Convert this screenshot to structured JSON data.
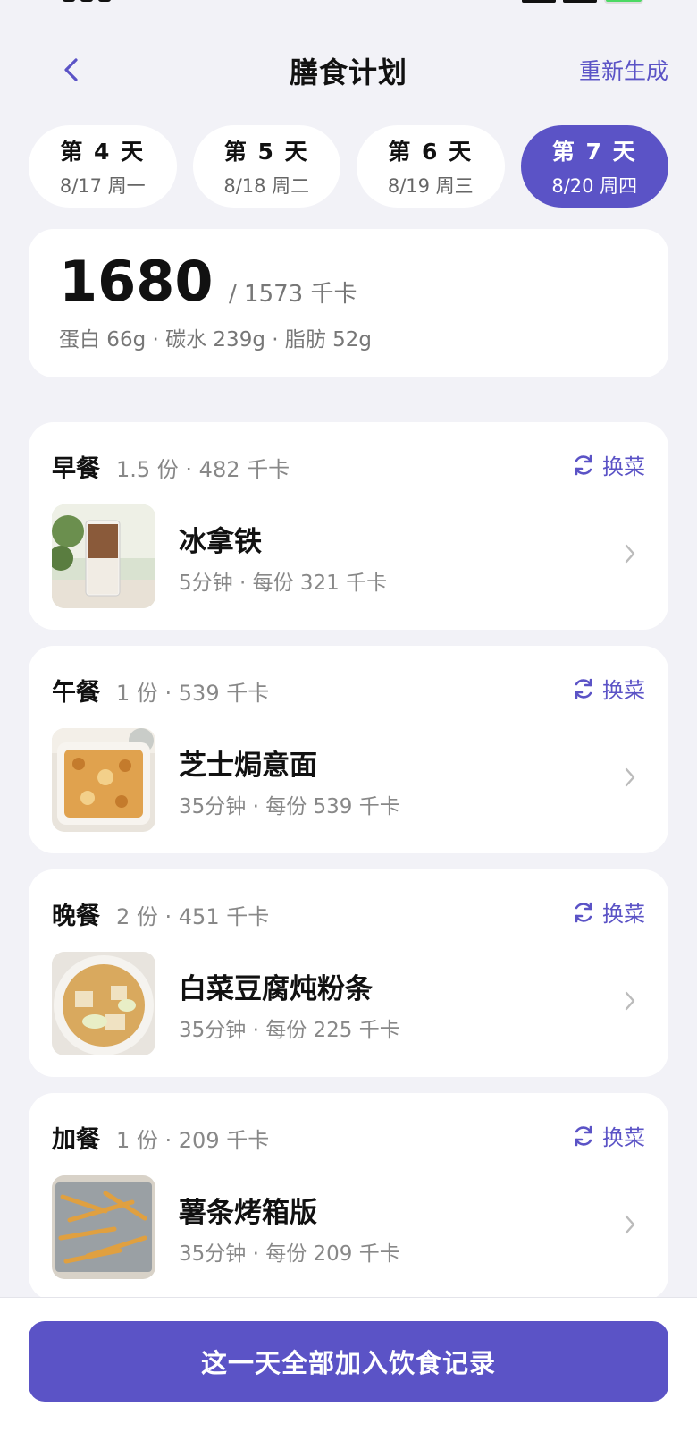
{
  "header": {
    "title": "膳食计划",
    "regenerate_label": "重新生成"
  },
  "day_tabs": [
    {
      "name": "第 4 天",
      "date": "8/17 周一",
      "active": false
    },
    {
      "name": "第 5 天",
      "date": "8/18 周二",
      "active": false
    },
    {
      "name": "第 6 天",
      "date": "8/19 周三",
      "active": false
    },
    {
      "name": "第 7 天",
      "date": "8/20 周四",
      "active": true
    }
  ],
  "summary": {
    "calories": "1680",
    "target": "/ 1573 千卡",
    "macros": "蛋白 66g · 碳水 239g · 脂肪 52g"
  },
  "meals": [
    {
      "type": "早餐",
      "summary": "1.5 份 · 482 千卡",
      "swap_label": "换菜",
      "dish": "冰拿铁",
      "meta": "5分钟 · 每份 321 千卡",
      "thumb_icon": "iced-latte-image"
    },
    {
      "type": "午餐",
      "summary": "1 份 · 539 千卡",
      "swap_label": "换菜",
      "dish": "芝士焗意面",
      "meta": "35分钟 · 每份 539 千卡",
      "thumb_icon": "baked-pasta-image"
    },
    {
      "type": "晚餐",
      "summary": "2 份 · 451 千卡",
      "swap_label": "换菜",
      "dish": "白菜豆腐炖粉条",
      "meta": "35分钟 · 每份 225 千卡",
      "thumb_icon": "cabbage-tofu-stew-image"
    },
    {
      "type": "加餐",
      "summary": "1 份 · 209 千卡",
      "swap_label": "换菜",
      "dish": "薯条烤箱版",
      "meta": "35分钟 · 每份 209 千卡",
      "thumb_icon": "fries-image"
    }
  ],
  "cta_label": "这一天全部加入饮食记录",
  "colors": {
    "accent": "#5b53c6",
    "background": "#f2f2f7",
    "card": "#ffffff"
  }
}
